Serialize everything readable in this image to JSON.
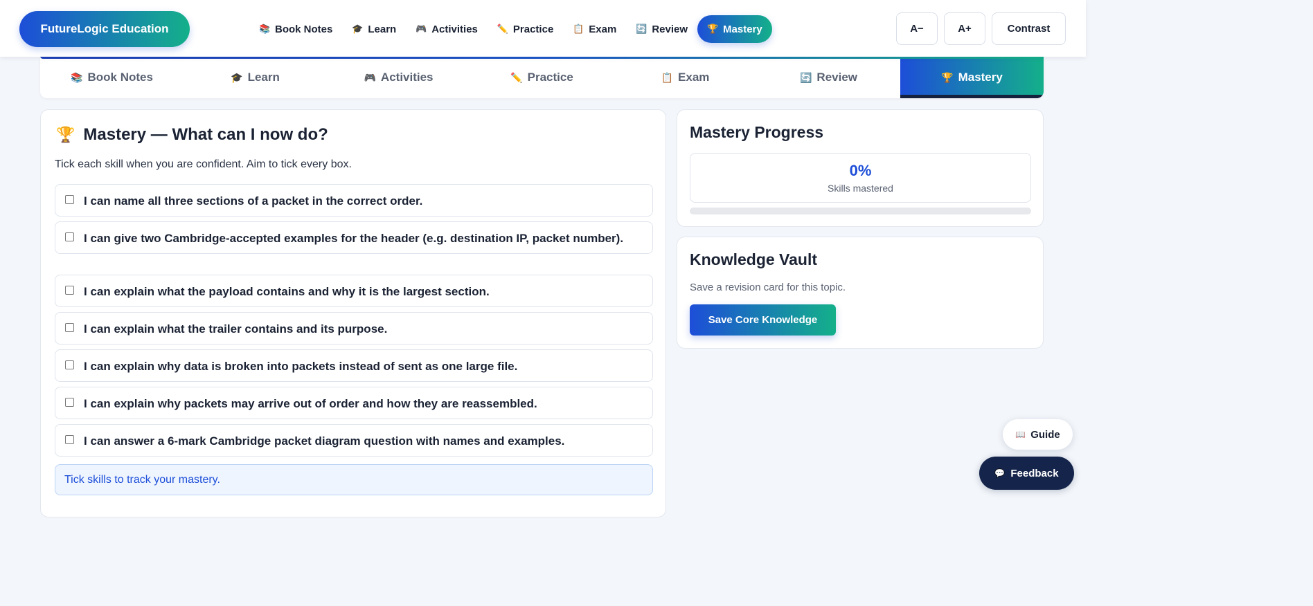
{
  "brand": {
    "name": "FutureLogic Education"
  },
  "top_nav": [
    {
      "icon": "📚",
      "label": "Book Notes",
      "active": false
    },
    {
      "icon": "🎓",
      "label": "Learn",
      "active": false
    },
    {
      "icon": "🎮",
      "label": "Activities",
      "active": false
    },
    {
      "icon": "✏️",
      "label": "Practice",
      "active": false
    },
    {
      "icon": "📋",
      "label": "Exam",
      "active": false
    },
    {
      "icon": "🔄",
      "label": "Review",
      "active": false
    },
    {
      "icon": "🏆",
      "label": "Mastery",
      "active": true
    }
  ],
  "accessibility": {
    "decrease": "A−",
    "increase": "A+",
    "contrast": "Contrast"
  },
  "tabs": [
    {
      "icon": "📚",
      "label": "Book Notes",
      "active": false
    },
    {
      "icon": "🎓",
      "label": "Learn",
      "active": false
    },
    {
      "icon": "🎮",
      "label": "Activities",
      "active": false
    },
    {
      "icon": "✏️",
      "label": "Practice",
      "active": false
    },
    {
      "icon": "📋",
      "label": "Exam",
      "active": false
    },
    {
      "icon": "🔄",
      "label": "Review",
      "active": false
    },
    {
      "icon": "🏆",
      "label": "Mastery",
      "active": true
    }
  ],
  "mastery": {
    "icon": "🏆",
    "title": "Mastery — What can I now do?",
    "subtitle": "Tick each skill when you are confident. Aim to tick every box.",
    "skills": [
      {
        "text": "I can name all three sections of a packet in the correct order.",
        "checked": false
      },
      {
        "text": "I can give two Cambridge-accepted examples for the header (e.g. destination IP, packet number).",
        "checked": false
      },
      {
        "text": "I can explain what the payload contains and why it is the largest section.",
        "checked": false
      },
      {
        "text": "I can explain what the trailer contains and its purpose.",
        "checked": false
      },
      {
        "text": "I can explain why data is broken into packets instead of sent as one large file.",
        "checked": false
      },
      {
        "text": "I can explain why packets may arrive out of order and how they are reassembled.",
        "checked": false
      },
      {
        "text": "I can answer a 6-mark Cambridge packet diagram question with names and examples.",
        "checked": false
      }
    ],
    "notice": "Tick skills to track your mastery."
  },
  "progress": {
    "title": "Mastery Progress",
    "percent_label": "0%",
    "percent_value": 0,
    "caption": "Skills mastered"
  },
  "vault": {
    "title": "Knowledge Vault",
    "subtitle": "Save a revision card for this topic.",
    "button": "Save Core Knowledge"
  },
  "floating": {
    "guide_icon": "📖",
    "guide": "Guide",
    "feedback_icon": "💬",
    "feedback": "Feedback"
  },
  "colors": {
    "accent_blue": "#1d4ed8",
    "accent_green": "#14b08a",
    "dark_navy": "#15244a"
  }
}
